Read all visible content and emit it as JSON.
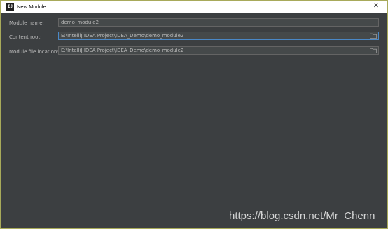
{
  "window": {
    "title": "New Module",
    "app_icon_text": "IJ",
    "close_glyph": "✕"
  },
  "form": {
    "module_name": {
      "label": "Module name:",
      "value": "demo_module2"
    },
    "content_root": {
      "label": "Content root:",
      "value": "E:\\IntelliJ IDEA Project\\IDEA_Demo\\demo_module2"
    },
    "module_file_location": {
      "label": "Module file location:",
      "value": "E:\\IntelliJ IDEA Project\\IDEA_Demo\\demo_module2"
    }
  },
  "icons": {
    "folder": "folder-icon",
    "close": "close-icon",
    "app": "intellij-idea-icon"
  },
  "watermark": {
    "text": "https://blog.csdn.net/Mr_Chenn"
  },
  "colors": {
    "dialog_bg": "#3c3f41",
    "field_bg": "#45494a",
    "focus_border": "#4a88c7",
    "window_border": "#a8aa5a"
  }
}
